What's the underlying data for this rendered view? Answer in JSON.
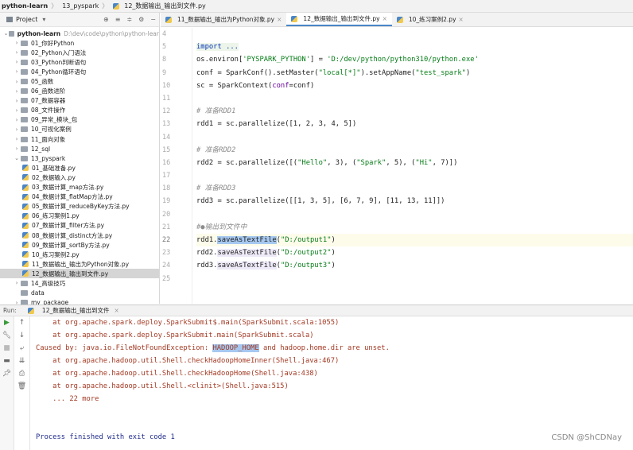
{
  "breadcrumb": [
    "python-learn",
    "13_pyspark",
    "12_数据输出_输出到文件.py"
  ],
  "project": {
    "title": "Project",
    "root": {
      "name": "python-learn",
      "path": "D:\\dev\\code\\python\\python-lear"
    },
    "items": [
      {
        "label": "01_你好Python",
        "type": "folder",
        "depth": 1
      },
      {
        "label": "02_Python入门语法",
        "type": "folder",
        "depth": 1
      },
      {
        "label": "03_Python判断语句",
        "type": "folder",
        "depth": 1
      },
      {
        "label": "04_Python循环语句",
        "type": "folder",
        "depth": 1
      },
      {
        "label": "05_函数",
        "type": "folder",
        "depth": 1
      },
      {
        "label": "06_函数进阶",
        "type": "folder",
        "depth": 1
      },
      {
        "label": "07_数据容器",
        "type": "folder",
        "depth": 1
      },
      {
        "label": "08_文件操作",
        "type": "folder",
        "depth": 1
      },
      {
        "label": "09_异常_模块_包",
        "type": "folder",
        "depth": 1
      },
      {
        "label": "10_可视化案例",
        "type": "folder",
        "depth": 1
      },
      {
        "label": "11_面向对象",
        "type": "folder",
        "depth": 1
      },
      {
        "label": "12_sql",
        "type": "folder",
        "depth": 1
      },
      {
        "label": "13_pyspark",
        "type": "folder",
        "depth": 1,
        "open": true
      },
      {
        "label": "01_基础准备.py",
        "type": "py",
        "depth": 2
      },
      {
        "label": "02_数据输入.py",
        "type": "py",
        "depth": 2
      },
      {
        "label": "03_数据计算_map方法.py",
        "type": "py",
        "depth": 2
      },
      {
        "label": "04_数据计算_flatMap方法.py",
        "type": "py",
        "depth": 2
      },
      {
        "label": "05_数据计算_reduceByKey方法.py",
        "type": "py",
        "depth": 2
      },
      {
        "label": "06_练习案例1.py",
        "type": "py",
        "depth": 2
      },
      {
        "label": "07_数据计算_filter方法.py",
        "type": "py",
        "depth": 2
      },
      {
        "label": "08_数据计算_distinct方法.py",
        "type": "py",
        "depth": 2
      },
      {
        "label": "09_数据计算_sortBy方法.py",
        "type": "py",
        "depth": 2
      },
      {
        "label": "10_练习案例2.py",
        "type": "py",
        "depth": 2
      },
      {
        "label": "11_数据输出_输出为Python对象.py",
        "type": "py",
        "depth": 2
      },
      {
        "label": "12_数据输出_输出到文件.py",
        "type": "py",
        "depth": 2,
        "selected": true
      },
      {
        "label": "14_高级技巧",
        "type": "folder",
        "depth": 1
      },
      {
        "label": "data",
        "type": "folder",
        "depth": 1,
        "nochev": true
      },
      {
        "label": "my_package",
        "type": "folder",
        "depth": 1
      }
    ]
  },
  "tabs": [
    {
      "label": "11_数据输出_输出为Python对象.py"
    },
    {
      "label": "12_数据输出_输出到文件.py",
      "active": true
    },
    {
      "label": "10_练习案例2.py"
    }
  ],
  "editor": {
    "current_line": "22",
    "lines": [
      {
        "n": "4",
        "seg": []
      },
      {
        "n": "5",
        "seg": [
          {
            "c": "kw fold",
            "t": "import ..."
          }
        ]
      },
      {
        "n": "8",
        "seg": [
          {
            "c": "",
            "t": "os.environ["
          },
          {
            "c": "str",
            "t": "'PYSPARK_PYTHON'"
          },
          {
            "c": "",
            "t": "] = "
          },
          {
            "c": "str",
            "t": "'D:/dev/python/python310/python.exe'"
          }
        ]
      },
      {
        "n": "9",
        "seg": [
          {
            "c": "",
            "t": "conf = SparkConf().setMaster("
          },
          {
            "c": "str",
            "t": "\"local[*]\""
          },
          {
            "c": "",
            "t": ").setAppName("
          },
          {
            "c": "str",
            "t": "\"test_spark\""
          },
          {
            "c": "",
            "t": ")"
          }
        ]
      },
      {
        "n": "10",
        "seg": [
          {
            "c": "",
            "t": "sc = SparkContext("
          },
          {
            "c": "kwarg",
            "t": "conf"
          },
          {
            "c": "",
            "t": "=conf)"
          }
        ]
      },
      {
        "n": "11",
        "seg": []
      },
      {
        "n": "12",
        "seg": [
          {
            "c": "cm",
            "t": "# 准备RDD1"
          }
        ]
      },
      {
        "n": "13",
        "seg": [
          {
            "c": "",
            "t": "rdd1 = sc.parallelize([1, 2, 3, 4, 5])"
          }
        ]
      },
      {
        "n": "14",
        "seg": []
      },
      {
        "n": "15",
        "seg": [
          {
            "c": "cm",
            "t": "# 准备RDD2"
          }
        ]
      },
      {
        "n": "16",
        "seg": [
          {
            "c": "",
            "t": "rdd2 = sc.parallelize([("
          },
          {
            "c": "str",
            "t": "\"Hello\""
          },
          {
            "c": "",
            "t": ", 3), ("
          },
          {
            "c": "str",
            "t": "\"Spark\""
          },
          {
            "c": "",
            "t": ", 5), ("
          },
          {
            "c": "str",
            "t": "\"Hi\""
          },
          {
            "c": "",
            "t": ", 7)])"
          }
        ]
      },
      {
        "n": "17",
        "seg": []
      },
      {
        "n": "18",
        "seg": [
          {
            "c": "cm",
            "t": "# 准备RDD3"
          }
        ]
      },
      {
        "n": "19",
        "seg": [
          {
            "c": "",
            "t": "rdd3 = sc.parallelize([[1, 3, 5], [6, 7, 9], [11, 13, 11]])"
          }
        ]
      },
      {
        "n": "20",
        "seg": []
      },
      {
        "n": "21",
        "seg": [
          {
            "c": "cm",
            "t": "#●输出到文件中"
          }
        ]
      },
      {
        "n": "22",
        "seg": [
          {
            "c": "",
            "t": "rdd1."
          },
          {
            "c": "hl",
            "t": "saveAsTextFile"
          },
          {
            "c": "",
            "t": "("
          },
          {
            "c": "str",
            "t": "\"D:/output1\""
          },
          {
            "c": "",
            "t": ")"
          }
        ]
      },
      {
        "n": "23",
        "seg": [
          {
            "c": "",
            "t": "rdd2."
          },
          {
            "c": "hl2",
            "t": "saveAsTextFile"
          },
          {
            "c": "",
            "t": "("
          },
          {
            "c": "str",
            "t": "\"D:/output2\""
          },
          {
            "c": "",
            "t": ")"
          }
        ]
      },
      {
        "n": "24",
        "seg": [
          {
            "c": "",
            "t": "rdd3."
          },
          {
            "c": "hl2",
            "t": "saveAsTextFile"
          },
          {
            "c": "",
            "t": "("
          },
          {
            "c": "str",
            "t": "\"D:/output3\""
          },
          {
            "c": "",
            "t": ")"
          }
        ]
      },
      {
        "n": "25",
        "seg": []
      }
    ]
  },
  "run": {
    "label": "Run:",
    "tab": "12_数据输出_输出到文件",
    "output": [
      {
        "seg": [
          {
            "c": "",
            "t": "    at org.apache.spark.deploy.SparkSubmit$.main(SparkSubmit.scala:1055)"
          }
        ]
      },
      {
        "seg": [
          {
            "c": "",
            "t": "    at org.apache.spark.deploy.SparkSubmit.main(SparkSubmit.scala)"
          }
        ]
      },
      {
        "seg": [
          {
            "c": "",
            "t": "Caused by: java.io.FileNotFoundException: "
          },
          {
            "c": "hl",
            "t": "HADOOP_HOME"
          },
          {
            "c": "",
            "t": " and hadoop.home.dir are unset."
          }
        ]
      },
      {
        "seg": [
          {
            "c": "",
            "t": "    at org.apache.hadoop.util.Shell.checkHadoopHomeInner(Shell.java:467)"
          }
        ]
      },
      {
        "seg": [
          {
            "c": "",
            "t": "    at org.apache.hadoop.util.Shell.checkHadoopHome(Shell.java:438)"
          }
        ]
      },
      {
        "seg": [
          {
            "c": "",
            "t": "    at org.apache.hadoop.util.Shell.<clinit>(Shell.java:515)"
          }
        ]
      },
      {
        "seg": [
          {
            "c": "",
            "t": "    ... 22 more"
          }
        ]
      },
      {
        "seg": []
      },
      {
        "seg": []
      },
      {
        "ok": true,
        "seg": [
          {
            "c": "",
            "t": "Process finished with exit code 1"
          }
        ]
      }
    ]
  },
  "watermark": "CSDN @ShCDNay",
  "colors": {
    "keyword": "#0033b3",
    "string": "#067d17",
    "error": "#a33a24",
    "selection": "#a6c8f0"
  }
}
